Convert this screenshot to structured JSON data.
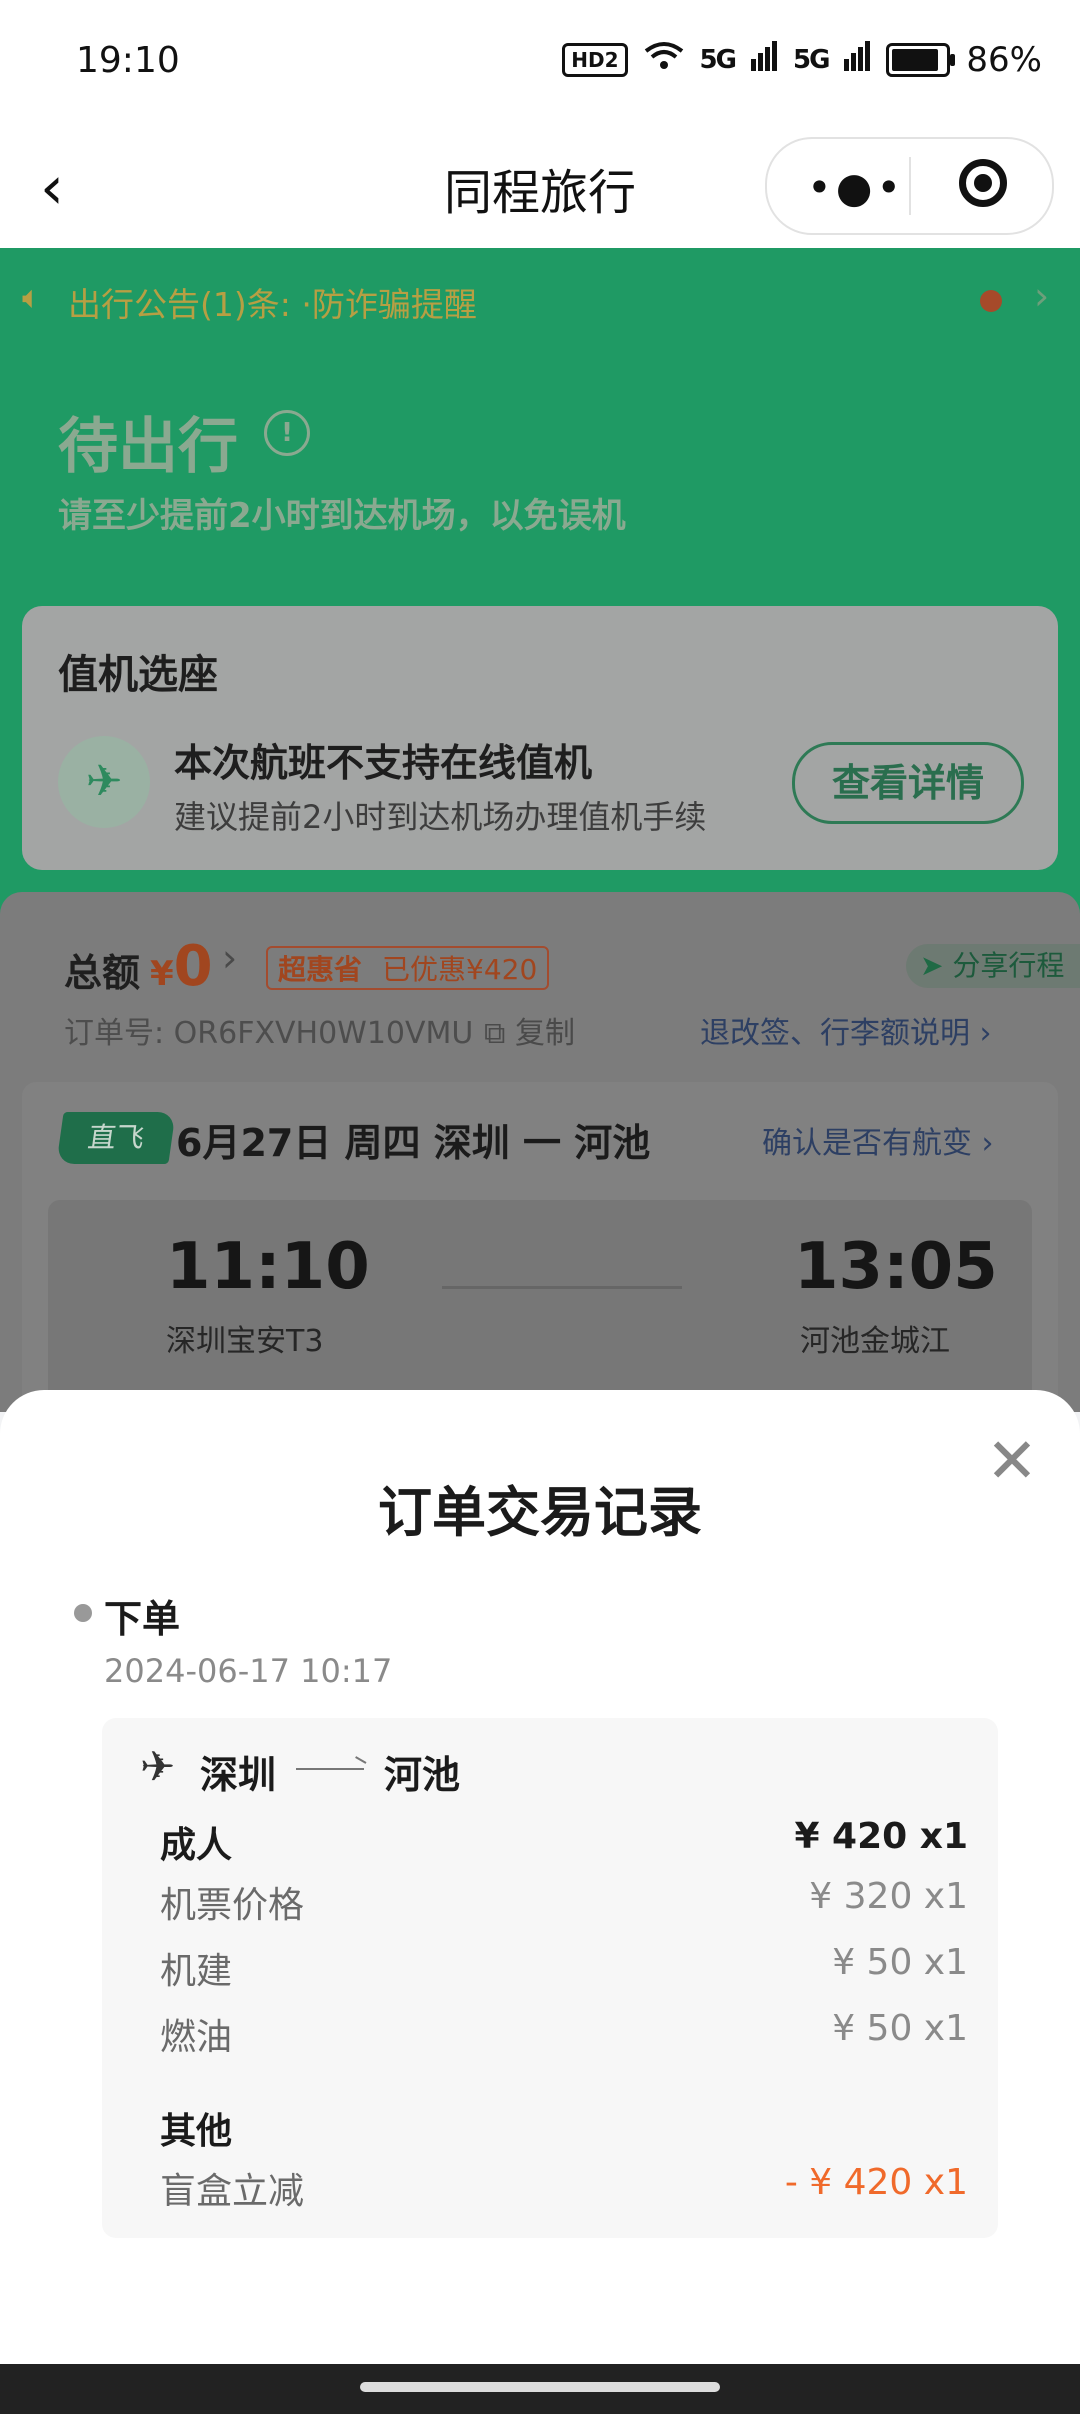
{
  "status_bar": {
    "time": "19:10",
    "hd_badge": "HD2",
    "signal1": "5G",
    "signal2": "5G",
    "battery_text": "86%",
    "battery_level": 0.86
  },
  "nav": {
    "title": "同程旅行",
    "back_icon": "chevron-left-icon",
    "more_icon": "more-dots-icon",
    "close_icon": "target-icon"
  },
  "notice": {
    "text": "出行公告(1)条:  ·防诈骗提醒"
  },
  "status": {
    "title": "待出行",
    "subtitle": "请至少提前2小时到达机场，以免误机"
  },
  "checkin": {
    "title": "值机选座",
    "main": "本次航班不支持在线值机",
    "sub": "建议提前2小时到达机场办理值机手续",
    "button": "查看详情"
  },
  "order": {
    "total_label": "总额",
    "currency": "¥",
    "total_value": "0",
    "promo_tag": "超惠省",
    "promo_saved": "已优惠¥420",
    "share_label": "分享行程",
    "order_no": "订单号: OR6FXVH0W10VMU",
    "copy_label": "复制",
    "rules_link": "退改签、行李额说明 ›",
    "direct_tag": "直飞",
    "route_date": "6月27日 周四 深圳 一 河池",
    "confirm_link": "确认是否有航变 ›",
    "dep_time": "11:10",
    "dep_airport": "深圳宝安T3",
    "arr_time": "13:05",
    "arr_airport": "河池金城江"
  },
  "sheet": {
    "title": "订单交易记录",
    "event": "下单",
    "event_time": "2024-06-17 10:17",
    "from": "深圳",
    "to": "河池",
    "rows": [
      {
        "label": "成人",
        "value": "¥ 420 x1"
      },
      {
        "label": "机票价格",
        "value": "¥ 320 x1"
      },
      {
        "label": "机建",
        "value": "¥ 50 x1"
      },
      {
        "label": "燃油",
        "value": "¥ 50 x1"
      },
      {
        "label": "其他",
        "value": ""
      },
      {
        "label": "盲盒立减",
        "value": "- ¥ 420 x1"
      }
    ]
  }
}
